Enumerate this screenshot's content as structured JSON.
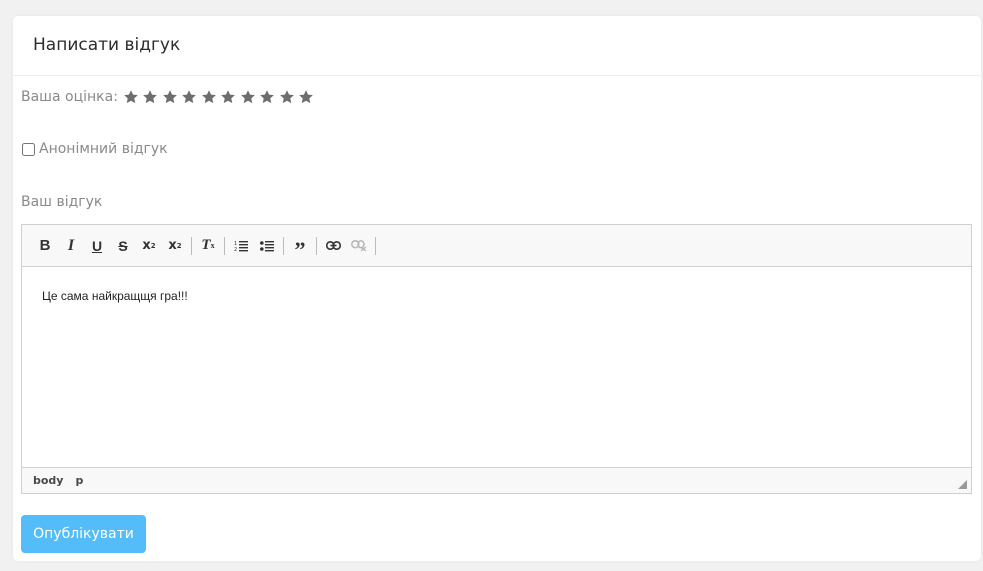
{
  "header": {
    "title": "Написати відгук"
  },
  "rating": {
    "label": "Ваша оцінка:",
    "max": 10,
    "star_color": "#6d6d6d"
  },
  "anonymous": {
    "label": "Анонімний відгук",
    "checked": false
  },
  "review": {
    "label": "Ваш відгук"
  },
  "editor": {
    "content": "Це сама найкращщя гра!!!",
    "toolbar": [
      {
        "name": "bold",
        "icon": "bold-icon",
        "glyph": "B"
      },
      {
        "name": "italic",
        "icon": "italic-icon",
        "glyph": "I"
      },
      {
        "name": "underline",
        "icon": "underline-icon",
        "glyph": "U"
      },
      {
        "name": "strikethrough",
        "icon": "strikethrough-icon",
        "glyph": "S"
      },
      {
        "name": "subscript",
        "icon": "subscript-icon",
        "glyph": "x₂"
      },
      {
        "name": "superscript",
        "icon": "superscript-icon",
        "glyph": "x²"
      },
      {
        "name": "remove-format",
        "icon": "remove-format-icon",
        "glyph": "Tx"
      },
      {
        "name": "numbered-list",
        "icon": "numbered-list-icon",
        "glyph": "1≡"
      },
      {
        "name": "bulleted-list",
        "icon": "bulleted-list-icon",
        "glyph": "•≡"
      },
      {
        "name": "blockquote",
        "icon": "quote-icon",
        "glyph": "”"
      },
      {
        "name": "link",
        "icon": "link-icon",
        "glyph": "link"
      },
      {
        "name": "unlink",
        "icon": "unlink-icon",
        "glyph": "unlink"
      }
    ],
    "path": [
      "body",
      "p"
    ]
  },
  "actions": {
    "publish_label": "Опублікувати",
    "publish_color": "#54bdf9"
  }
}
